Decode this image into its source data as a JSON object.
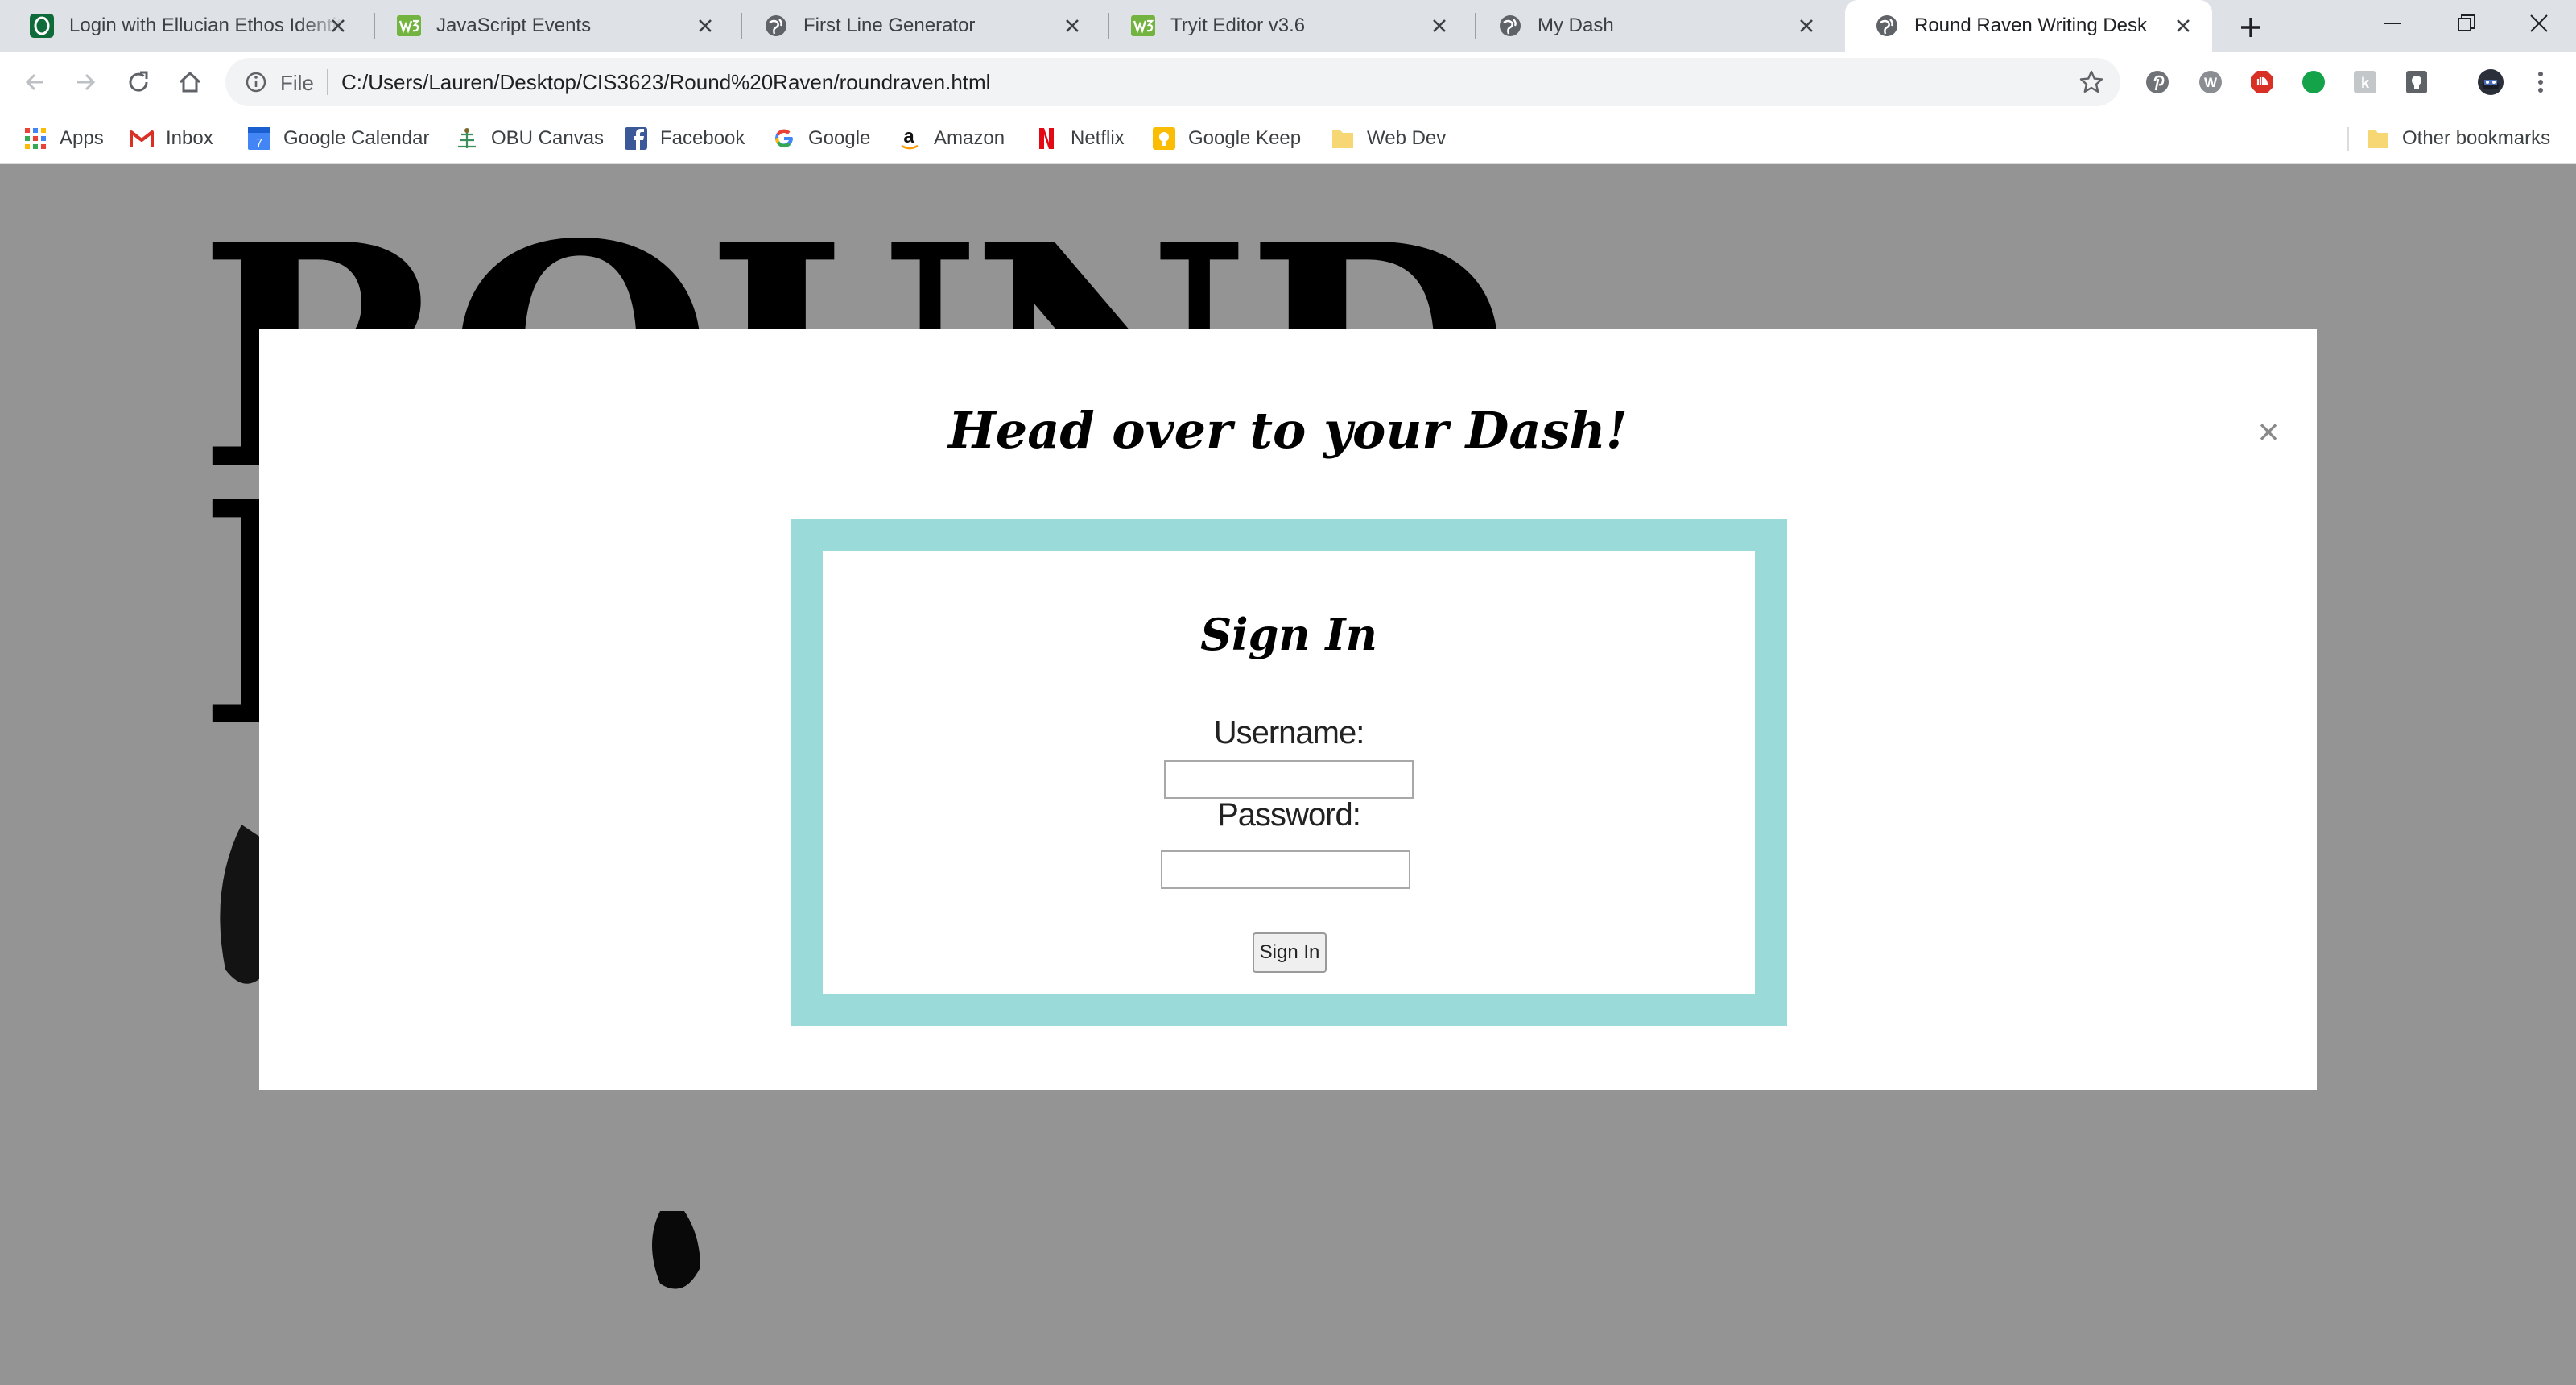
{
  "browser": {
    "tabs": [
      {
        "title": "Login with Ellucian Ethos Identity",
        "favicon": "ellucian-icon",
        "active": false
      },
      {
        "title": "JavaScript Events",
        "favicon": "w3schools-icon",
        "active": false
      },
      {
        "title": "First Line Generator",
        "favicon": "globe-icon",
        "active": false
      },
      {
        "title": "Tryit Editor v3.6",
        "favicon": "w3schools-icon",
        "active": false
      },
      {
        "title": "My Dash",
        "favicon": "globe-icon",
        "active": false
      },
      {
        "title": "Round Raven Writing Desk",
        "favicon": "globe-icon",
        "active": true
      }
    ],
    "address_scheme_label": "File",
    "url": "C:/Users/Lauren/Desktop/CIS3623/Round%20Raven/roundraven.html",
    "bookmarks": [
      {
        "label": "Apps",
        "icon": "apps-grid-icon"
      },
      {
        "label": "Inbox",
        "icon": "gmail-icon"
      },
      {
        "label": "Google Calendar",
        "icon": "calendar-icon"
      },
      {
        "label": "OBU Canvas",
        "icon": "canvas-icon"
      },
      {
        "label": "Facebook",
        "icon": "facebook-icon"
      },
      {
        "label": "Google",
        "icon": "google-icon"
      },
      {
        "label": "Amazon",
        "icon": "amazon-icon"
      },
      {
        "label": "Netflix",
        "icon": "netflix-icon"
      },
      {
        "label": "Google Keep",
        "icon": "keep-icon"
      },
      {
        "label": "Web Dev",
        "icon": "folder-icon"
      }
    ],
    "other_bookmarks_label": "Other bookmarks"
  },
  "page": {
    "background_logo": {
      "line1": "ROUND",
      "line2": "R"
    },
    "modal": {
      "title": "Head over to your Dash!",
      "close_symbol": "×",
      "signin": {
        "title": "Sign In",
        "username_label": "Username:",
        "password_label": "Password:",
        "username_value": "",
        "password_value": "",
        "button_label": "Sign In"
      }
    }
  },
  "colors": {
    "tabstrip_bg": "#dee1e6",
    "frame_teal": "#9adbd9",
    "overlay": "rgba(0,0,0,0.42)"
  }
}
